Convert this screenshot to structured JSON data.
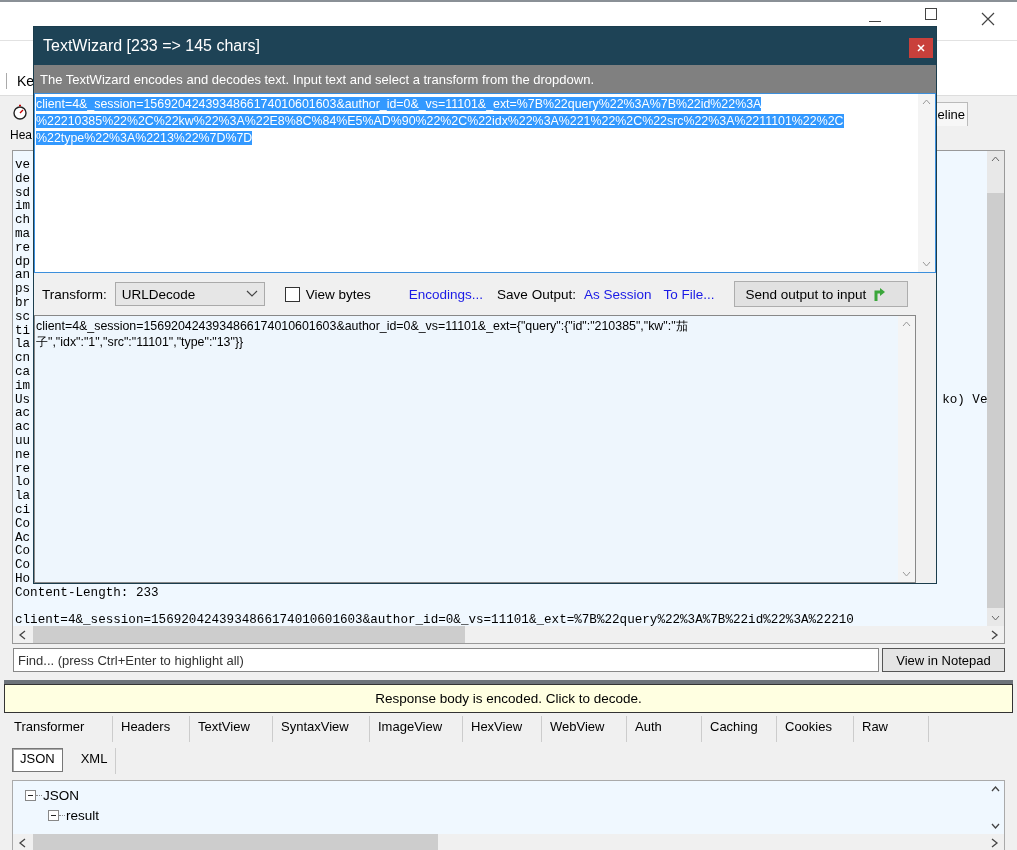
{
  "toolbar": {
    "label": "Ke"
  },
  "inspector_tabs": [
    {
      "label": "eline"
    }
  ],
  "request_subtab": {
    "label": "Hea"
  },
  "request_text": {
    "lines": [
      {
        "text": "ve"
      },
      {
        "text": "de"
      },
      {
        "text": "sd"
      },
      {
        "text": "im"
      },
      {
        "text": "ch"
      },
      {
        "text": "ma"
      },
      {
        "text": "re"
      },
      {
        "text": "dp"
      },
      {
        "text": "an"
      },
      {
        "text": "ps"
      },
      {
        "text": "br"
      },
      {
        "text": "sc"
      },
      {
        "text": "ti"
      },
      {
        "text": "la"
      },
      {
        "text": "cn"
      },
      {
        "text": "ca"
      },
      {
        "text": "im"
      },
      {
        "text": "Us",
        "tail": "ko) Ve"
      },
      {
        "text": "ac"
      },
      {
        "text": "ac"
      },
      {
        "text": "uu"
      },
      {
        "text": "ne"
      },
      {
        "text": "re"
      },
      {
        "text": "lo"
      },
      {
        "text": "la"
      },
      {
        "text": "ci"
      },
      {
        "text": "Co"
      },
      {
        "text": "Ac"
      },
      {
        "text": "Co"
      },
      {
        "text": "Co"
      },
      {
        "text": "Ho"
      }
    ],
    "content_length": "Content-Length: 233",
    "body": "client=4&_session=1569204243934866174010601603&author_id=0&_vs=11101&_ext=%7B%22query%22%3A%7B%22id%22%3A%22210"
  },
  "find": {
    "placeholder": "Find... (press Ctrl+Enter to highlight all)",
    "button": "View in Notepad"
  },
  "notice": "Response body is encoded. Click to decode.",
  "response_tabs": [
    {
      "label": "Transformer",
      "selected": false
    },
    {
      "label": "Headers",
      "selected": false
    },
    {
      "label": "TextView",
      "selected": false
    },
    {
      "label": "SyntaxView",
      "selected": false
    },
    {
      "label": "ImageView",
      "selected": false
    },
    {
      "label": "HexView",
      "selected": false
    },
    {
      "label": "WebView",
      "selected": false
    },
    {
      "label": "Auth",
      "selected": false
    },
    {
      "label": "Caching",
      "selected": false
    },
    {
      "label": "Cookies",
      "selected": false
    },
    {
      "label": "Raw",
      "selected": false
    },
    {
      "label": "JSON",
      "selected": true
    },
    {
      "label": "XML",
      "selected": false
    }
  ],
  "tree": [
    {
      "label": "JSON",
      "expanded": true,
      "children": [
        {
          "label": "result",
          "expanded": true
        }
      ]
    }
  ],
  "dialog": {
    "title": "TextWizard [233 => 145 chars]",
    "description": "The TextWizard encodes and decodes text. Input text and select a transform from the dropdown.",
    "input_lines": [
      "client=4&_session=1569204243934866174010601603&author_id=0&_vs=11101&_ext=%7B%22query%22%3A%7B%22id%22%3A",
      "%22210385%22%2C%22kw%22%3A%22E8%8C%84%E5%AD%90%22%2C%22idx%22%3A%221%22%2C%22src%22%3A%2211101%22%2C",
      "%22type%22%3A%2213%22%7D%7D"
    ],
    "transform_label": "Transform:",
    "transform": "URLDecode",
    "view_bytes": {
      "label": "View bytes",
      "checked": false
    },
    "encodings_link": "Encodings...",
    "save_output_label": "Save Output:",
    "save_links": [
      "As Session",
      "To File..."
    ],
    "send_button": "Send output to input",
    "output_lines": [
      "client=4&_session=1569204243934866174010601603&author_id=0&_vs=11101&_ext={\"query\":{\"id\":\"210385\",\"kw\":\"茄",
      "子\",\"idx\":\"1\",\"src\":\"11101\",\"type\":\"13\"}}"
    ]
  }
}
